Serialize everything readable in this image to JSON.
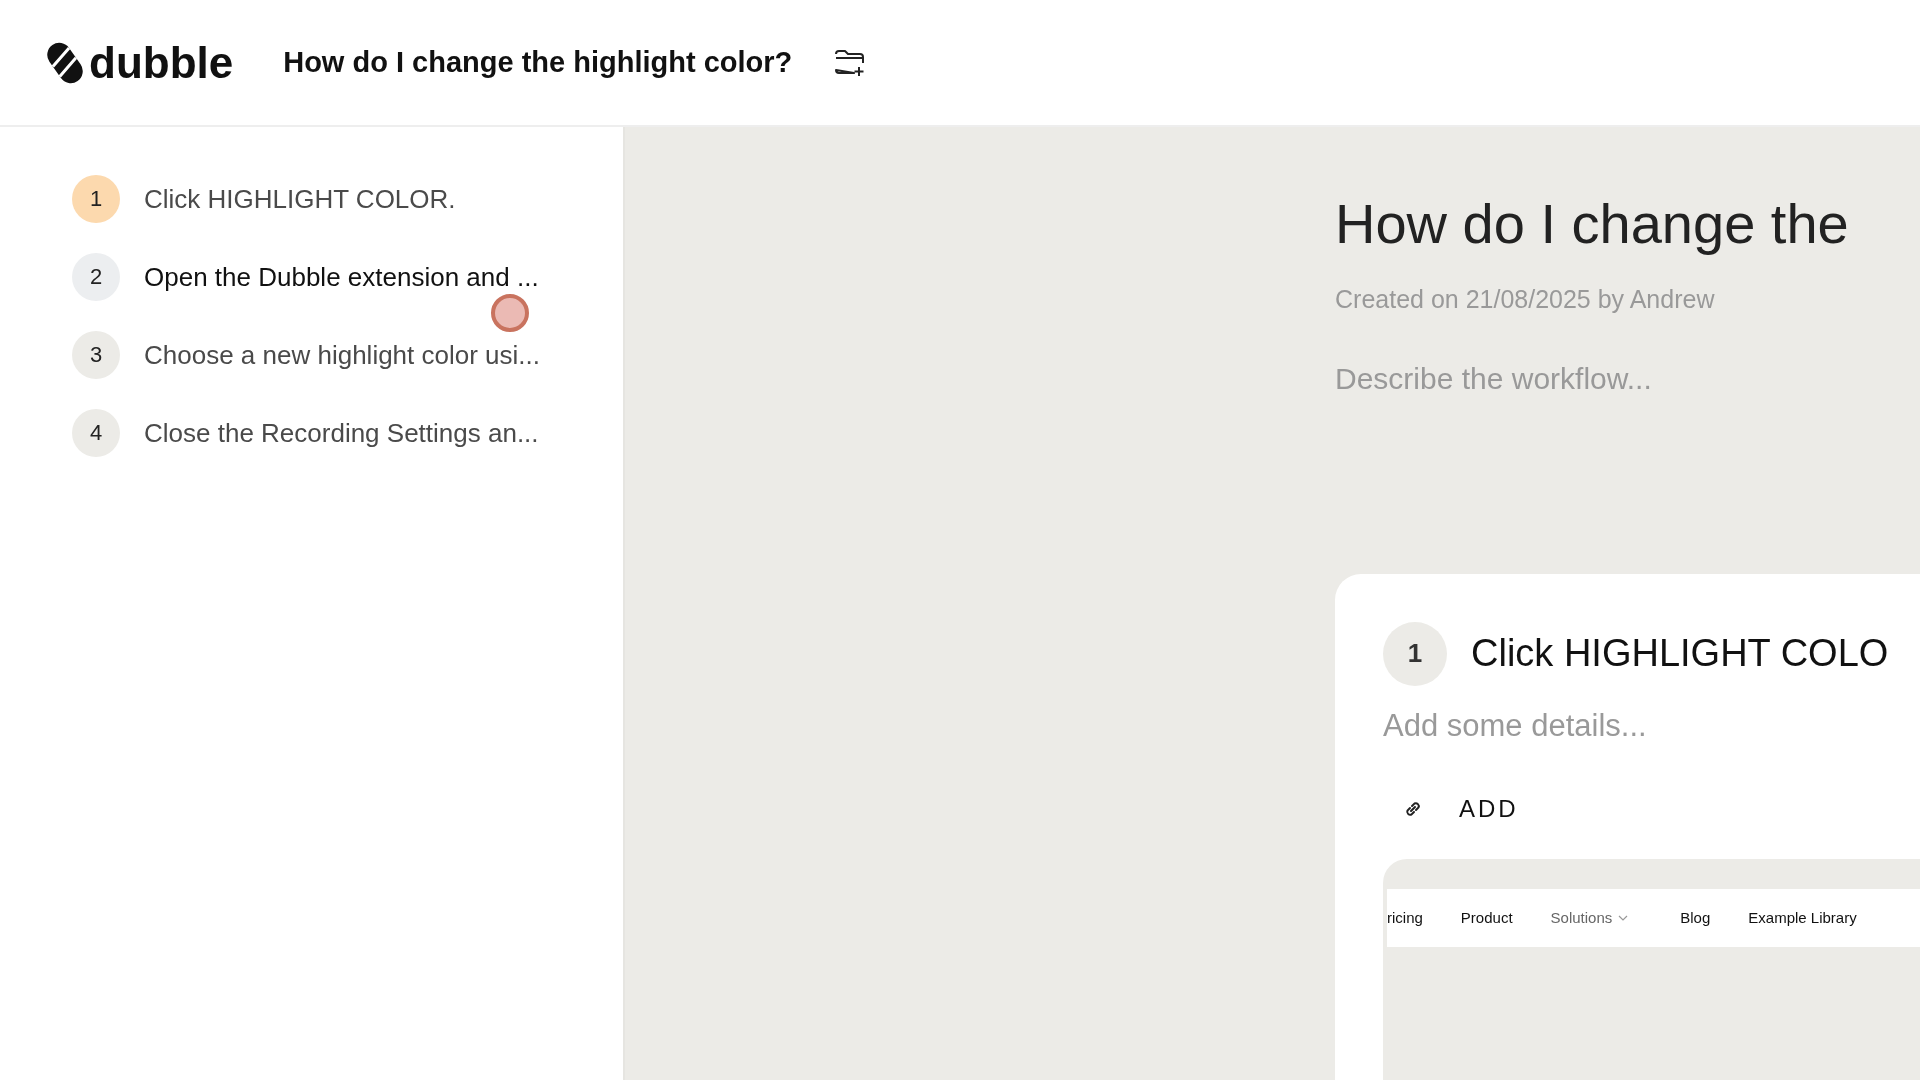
{
  "header": {
    "logo": "dubble",
    "title": "How do I change the highlight color?"
  },
  "steps": [
    {
      "number": "1",
      "text": "Click HIGHLIGHT COLOR.",
      "selected": true,
      "hovered": false
    },
    {
      "number": "2",
      "text": "Open the Dubble extension and ...",
      "selected": false,
      "hovered": true
    },
    {
      "number": "3",
      "text": "Choose a new highlight color usi...",
      "selected": false,
      "hovered": false
    },
    {
      "number": "4",
      "text": "Close the Recording Settings an...",
      "selected": false,
      "hovered": false
    }
  ],
  "document": {
    "title": "How do I change the",
    "meta": "Created on 21/08/2025 by Andrew",
    "description_placeholder": "Describe the workflow..."
  },
  "step_card": {
    "number": "1",
    "title": "Click HIGHLIGHT COLO",
    "details_placeholder": "Add some details...",
    "add_label": "ADD",
    "screenshot_nav": [
      {
        "label": "ricing",
        "muted": false,
        "dropdown": false
      },
      {
        "label": "Product",
        "muted": false,
        "dropdown": false
      },
      {
        "label": "Solutions",
        "muted": true,
        "dropdown": true
      },
      {
        "label": "Blog",
        "muted": false,
        "dropdown": false
      },
      {
        "label": "Example Library",
        "muted": false,
        "dropdown": false
      }
    ]
  }
}
